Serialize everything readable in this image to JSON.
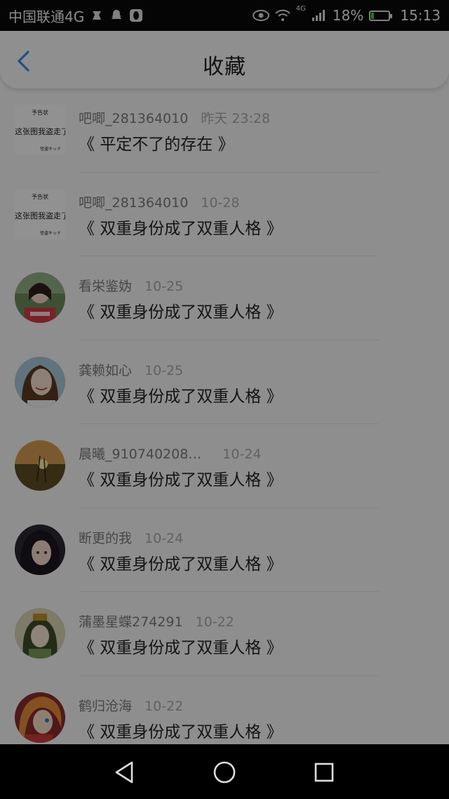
{
  "status_bar": {
    "carrier": "中国联通4G",
    "network": "4G",
    "battery": "18%",
    "battery_level": 0.18,
    "time": "15:13",
    "icons": [
      "steam-icon",
      "snapchat-icon",
      "qq-icon",
      "eye-icon",
      "wifi-icon",
      "signal-icon",
      "battery-icon"
    ]
  },
  "header": {
    "title": "收藏",
    "back_icon": "chevron-left-icon"
  },
  "square_avatar_text": {
    "line1": "予告状",
    "line2": "这张图我盗走了",
    "line3": "怪盗キッド"
  },
  "items": [
    {
      "user": "吧唧_281364010",
      "date": "昨天 23:28",
      "title": "《 平定不了的存在 》",
      "avatar": "notice-image"
    },
    {
      "user": "吧唧_281364010",
      "date": "10-28",
      "title": "《 双重身份成了双重人格 》",
      "avatar": "notice-image"
    },
    {
      "user": "看栄鉴妫",
      "date": "10-25",
      "title": "《 双重身份成了双重人格 》",
      "avatar": "girl-photo"
    },
    {
      "user": "龚赖如心",
      "date": "10-25",
      "title": "《 双重身份成了双重人格 》",
      "avatar": "smiling-girl-photo"
    },
    {
      "user": "晨曦_910740208…",
      "date": "10-24",
      "title": "《 双重身份成了双重人格 》",
      "avatar": "sunset-photo"
    },
    {
      "user": "断更的我",
      "date": "10-24",
      "title": "《 双重身份成了双重人格 》",
      "avatar": "anime-dark-hair"
    },
    {
      "user": "蒲墨星蝶274291",
      "date": "10-22",
      "title": "《 双重身份成了双重人格 》",
      "avatar": "anime-green-hair"
    },
    {
      "user": "鹤归沧海",
      "date": "10-22",
      "title": "《 双重身份成了双重人格 》",
      "avatar": "anime-orange-hair"
    }
  ],
  "nav_bar": {
    "buttons": [
      "back-triangle-icon",
      "home-circle-icon",
      "recents-square-icon"
    ]
  },
  "colors": {
    "accent": "#3b8ee0",
    "battery_fill": "#3fcf4a"
  }
}
